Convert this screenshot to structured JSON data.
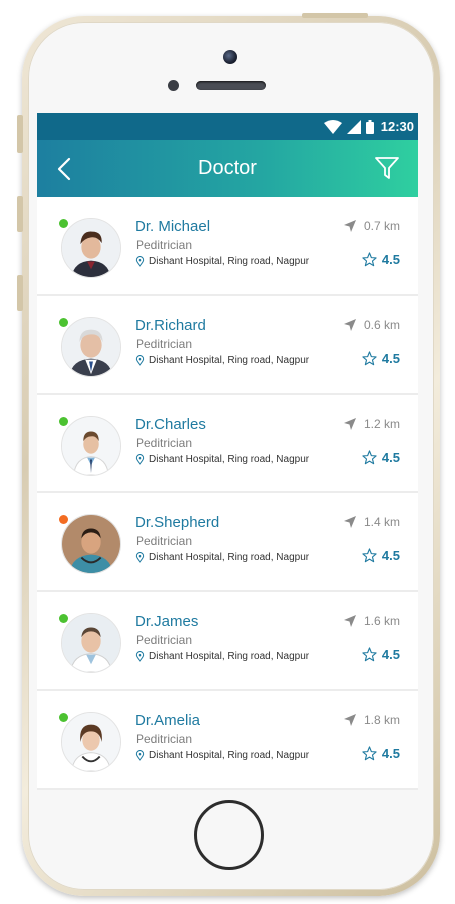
{
  "status_bar": {
    "time": "12:30"
  },
  "app_bar": {
    "title": "Doctor"
  },
  "colors": {
    "accent": "#1f7aa0",
    "online": "#4cc231",
    "away": "#f36c22"
  },
  "icons": {
    "back": "chevron-left-icon",
    "filter": "filter-icon",
    "location": "map-pin-icon",
    "distance": "navigation-arrow-icon",
    "rating": "star-outline-icon"
  },
  "doctors": [
    {
      "name": "Dr. Michael",
      "specialty": "Peditrician",
      "address": "Dishant Hospital, Ring road, Nagpur",
      "distance": "0.7 km",
      "rating": "4.5",
      "status": "online"
    },
    {
      "name": "Dr.Richard",
      "specialty": "Peditrician",
      "address": "Dishant Hospital, Ring road, Nagpur",
      "distance": "0.6 km",
      "rating": "4.5",
      "status": "online"
    },
    {
      "name": "Dr.Charles",
      "specialty": "Peditrician",
      "address": "Dishant Hospital, Ring road, Nagpur",
      "distance": "1.2 km",
      "rating": "4.5",
      "status": "online"
    },
    {
      "name": "Dr.Shepherd",
      "specialty": "Peditrician",
      "address": "Dishant Hospital, Ring road, Nagpur",
      "distance": "1.4 km",
      "rating": "4.5",
      "status": "away"
    },
    {
      "name": "Dr.James",
      "specialty": "Peditrician",
      "address": "Dishant Hospital, Ring road, Nagpur",
      "distance": "1.6 km",
      "rating": "4.5",
      "status": "online"
    },
    {
      "name": "Dr.Amelia",
      "specialty": "Peditrician",
      "address": "Dishant Hospital, Ring road, Nagpur",
      "distance": "1.8 km",
      "rating": "4.5",
      "status": "online"
    }
  ]
}
